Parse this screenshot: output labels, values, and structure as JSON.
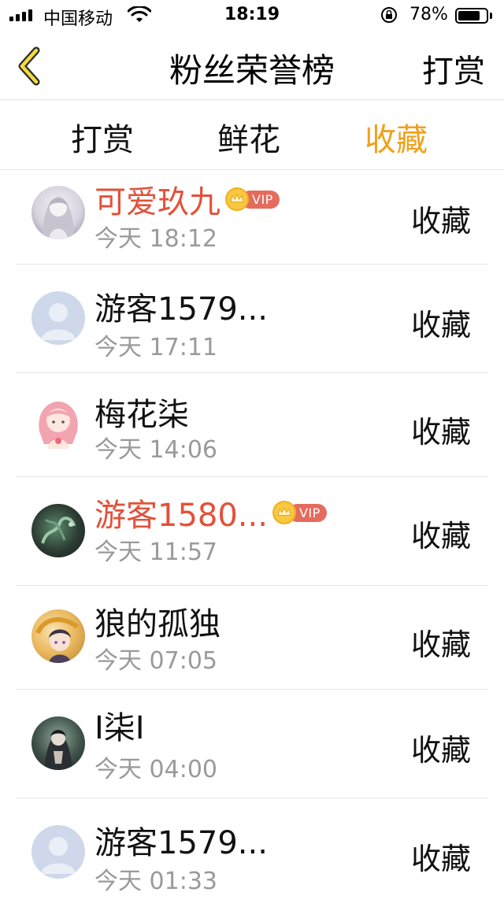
{
  "status_bar": {
    "carrier": "中国移动",
    "time": "18:19",
    "battery": "78%",
    "battery_level": 0.78
  },
  "nav": {
    "title": "粉丝荣誉榜",
    "right_button": "打赏",
    "back_icon": "chevron-left-icon"
  },
  "tabs": [
    {
      "label": "打赏",
      "active": false
    },
    {
      "label": "鲜花",
      "active": false
    },
    {
      "label": "收藏",
      "active": true
    }
  ],
  "colors": {
    "accent": "#f0a11b",
    "vip_name": "#e4503a",
    "time_text": "#9a9a9a"
  },
  "fans": [
    {
      "name": "可爱玖九",
      "vip": true,
      "vip_label": "VIP",
      "time": "今天 18:12",
      "action": "收藏",
      "avatar": "anime-girl-avatar"
    },
    {
      "name": "游客1579...",
      "vip": false,
      "time": "今天 17:11",
      "action": "收藏",
      "avatar": "default-user-avatar"
    },
    {
      "name": "梅花柒",
      "vip": false,
      "time": "今天 14:06",
      "action": "收藏",
      "avatar": "pink-girl-avatar"
    },
    {
      "name": "游客1580...",
      "vip": true,
      "vip_label": "VIP",
      "time": "今天 11:57",
      "action": "收藏",
      "avatar": "dragon-avatar"
    },
    {
      "name": "狼的孤独",
      "vip": false,
      "time": "今天 07:05",
      "action": "收藏",
      "avatar": "anime-boy-avatar"
    },
    {
      "name": "I柒I",
      "vip": false,
      "time": "今天 04:00",
      "action": "收藏",
      "avatar": "dark-character-avatar"
    },
    {
      "name": "游客1579...",
      "vip": false,
      "time": "今天 01:33",
      "action": "收藏",
      "avatar": "default-user-avatar"
    }
  ]
}
